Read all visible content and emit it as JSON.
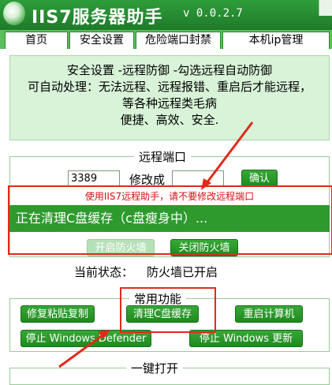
{
  "app": {
    "title": "IIS7服务器助手",
    "version": "v 0.0.2.7"
  },
  "tabs": [
    "首页",
    "安全设置",
    "危险端口封禁",
    "本机ip管理"
  ],
  "info_lines": [
    "安全设置 -远程防御 -勾选远程自动防御",
    "可自动处理：无法远程、远程报错、重启后才能远程，",
    "等各种远程类毛病",
    "便捷、高效、安全."
  ],
  "remote_port": {
    "group_title": "远程端口",
    "port_value": "3389",
    "modify_label": "修改成",
    "new_port_value": "",
    "confirm_label": "确认",
    "warning": "使用IIS7远程助手，请不要修改远程端口",
    "progress_text": "正在清理C盘缓存（c盘瘦身中）...",
    "open_firewall_label": "开启防火墙",
    "close_firewall_label": "关闭防火墙",
    "status_label": "当前状态：",
    "status_value": "防火墙已开启"
  },
  "common": {
    "group_title": "常用功能",
    "buttons": [
      "修复粘贴复制",
      "清理C盘缓存",
      "重启计算机",
      "停止 Windows Defender",
      "停止 Windows 更新"
    ]
  },
  "one_click": {
    "group_title": "一键打开"
  },
  "colors": {
    "brand_green": "#2e9a2e",
    "info_bg": "#d8f3d8",
    "annotation_red": "#e02a1a",
    "warning_red": "#d01010"
  }
}
